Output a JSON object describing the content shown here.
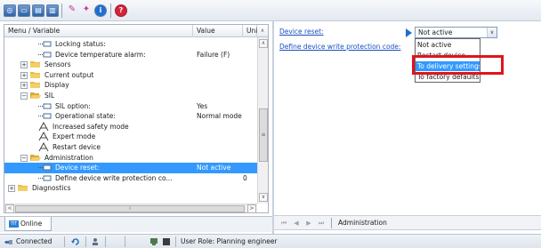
{
  "toolbar": {
    "buttons": [
      {
        "icon": "online-icon"
      },
      {
        "icon": "window-icon"
      },
      {
        "icon": "window-split-icon"
      },
      {
        "icon": "window-list-icon"
      },
      {
        "icon": "wizard-icon"
      },
      {
        "icon": "sparkle-icon"
      },
      {
        "icon": "info-icon"
      },
      {
        "icon": "help-icon"
      }
    ]
  },
  "tree": {
    "headers": {
      "menu": "Menu / Variable",
      "value": "Value",
      "unit": "Uni"
    },
    "rows": [
      {
        "label": "Locking status:",
        "value": "",
        "unit": "",
        "type": "param",
        "indent": 2
      },
      {
        "label": "Device temperature alarm:",
        "value": "Failure (F)",
        "unit": "",
        "type": "param",
        "indent": 2
      },
      {
        "label": "Sensors",
        "value": "",
        "unit": "",
        "type": "folder",
        "indent": 1,
        "expander": "+"
      },
      {
        "label": "Current output",
        "value": "",
        "unit": "",
        "type": "folder",
        "indent": 1,
        "expander": "+"
      },
      {
        "label": "Display",
        "value": "",
        "unit": "",
        "type": "folder",
        "indent": 1,
        "expander": "+"
      },
      {
        "label": "SIL",
        "value": "",
        "unit": "",
        "type": "folder-open",
        "indent": 1,
        "expander": "−"
      },
      {
        "label": "SIL option:",
        "value": "Yes",
        "unit": "",
        "type": "param",
        "indent": 2
      },
      {
        "label": "Operational state:",
        "value": "Normal mode",
        "unit": "",
        "type": "param",
        "indent": 2
      },
      {
        "label": "Increased safety mode",
        "value": "",
        "unit": "",
        "type": "wizard",
        "indent": 2
      },
      {
        "label": "Expert mode",
        "value": "",
        "unit": "",
        "type": "wizard",
        "indent": 2
      },
      {
        "label": "Restart device",
        "value": "",
        "unit": "",
        "type": "wizard",
        "indent": 2
      },
      {
        "label": "Administration",
        "value": "",
        "unit": "",
        "type": "folder-open",
        "indent": 1,
        "expander": "−"
      },
      {
        "label": "Device reset:",
        "value": "Not active",
        "unit": "",
        "type": "param",
        "indent": 2,
        "selected": true
      },
      {
        "label": "Define device write protection co...",
        "value": "",
        "unit": "0",
        "type": "param",
        "indent": 2
      },
      {
        "label": "Diagnostics",
        "value": "",
        "unit": "",
        "type": "folder",
        "indent": 0,
        "expander": "+"
      }
    ]
  },
  "tab": {
    "label": "Online",
    "icon_text": "TIT"
  },
  "right": {
    "device_reset_label": "Device reset:",
    "write_protection_label": "Define device write protection code:",
    "combo_value": "Not active",
    "options": [
      "Not active",
      "Restart device",
      "To delivery settings",
      "To factory defaults"
    ],
    "highlighted_option_index": 2
  },
  "navbar": {
    "location": "Administration"
  },
  "statusbar": {
    "connection": "Connected",
    "user_role": "User Role: Planning engineer"
  },
  "colors": {
    "selection": "#3399ff",
    "link": "#1a4fc0",
    "annotation": "#e0141c"
  }
}
